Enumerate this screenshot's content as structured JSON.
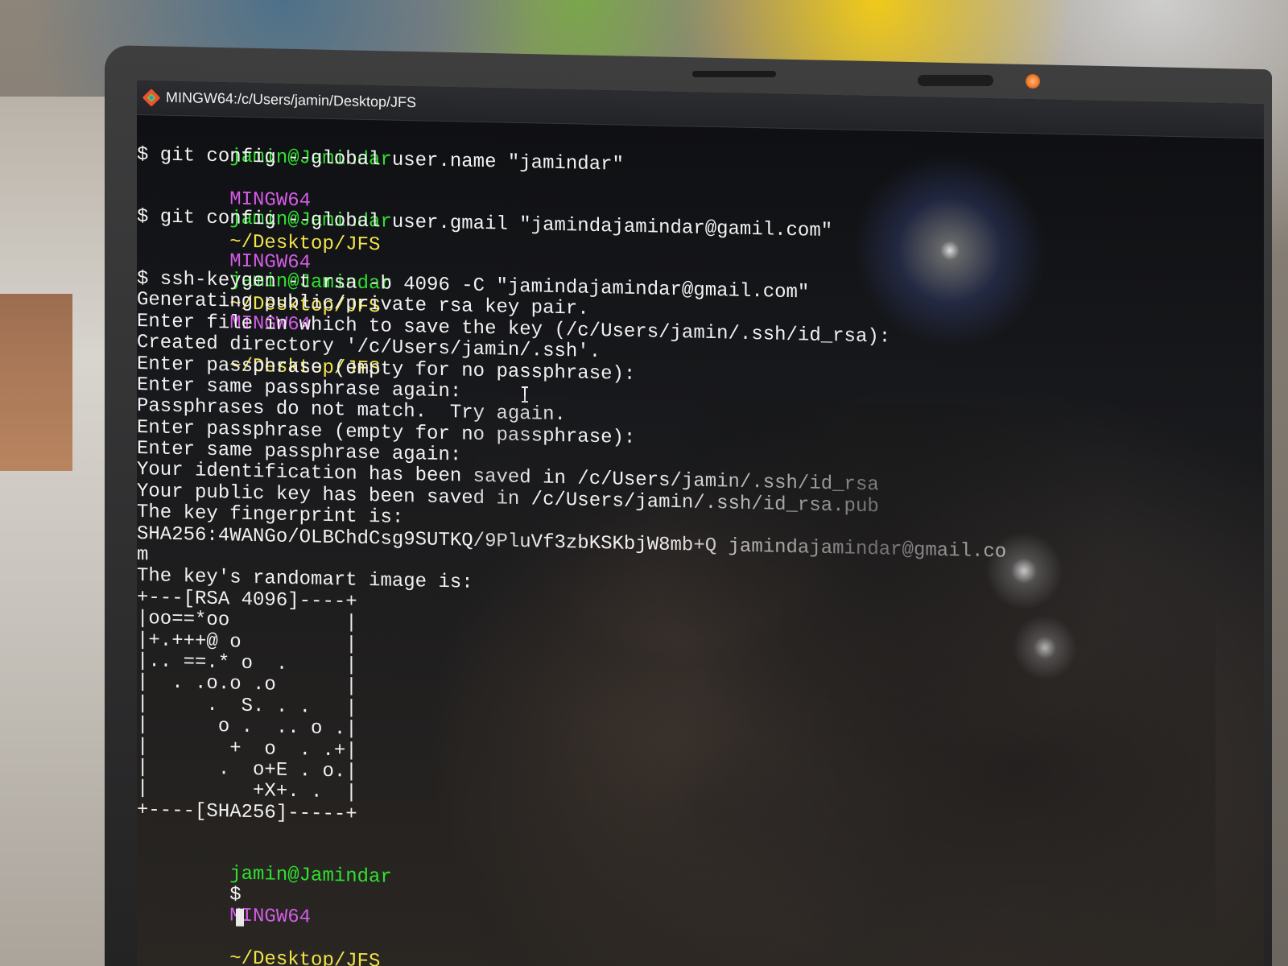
{
  "window": {
    "title": "MINGW64:/c/Users/jamin/Desktop/JFS"
  },
  "terminal": {
    "entries": [
      {
        "prompt": {
          "user": "jamin@Jamindar",
          "host": "MINGW64",
          "path": "~/Desktop/JFS"
        },
        "command": "$ git config --global user.name \"jamindar\"",
        "output": []
      },
      {
        "prompt": {
          "user": "jamin@Jamindar",
          "host": "MINGW64",
          "path": "~/Desktop/JFS"
        },
        "command": "$ git config --global user.gmail \"jamindajamindar@gamil.com\"",
        "output": []
      },
      {
        "prompt": {
          "user": "jamin@Jamindar",
          "host": "MINGW64",
          "path": "~/Desktop/JFS"
        },
        "command": "$ ssh-keygen -t rsa -b 4096 -C \"jamindajamindar@gmail.com\"",
        "output": [
          "Generating public/private rsa key pair.",
          "Enter file in which to save the key (/c/Users/jamin/.ssh/id_rsa):",
          "Created directory '/c/Users/jamin/.ssh'.",
          "Enter passphrase (empty for no passphrase):",
          "Enter same passphrase again:",
          "Passphrases do not match.  Try again.",
          "Enter passphrase (empty for no passphrase):",
          "Enter same passphrase again:",
          "Your identification has been saved in /c/Users/jamin/.ssh/id_rsa",
          "Your public key has been saved in /c/Users/jamin/.ssh/id_rsa.pub",
          "The key fingerprint is:",
          "SHA256:4WANGo/OLBChdCsg9SUTKQ/9PluVf3zbKSKbjW8mb+Q jamindajamindar@gmail.co",
          "m",
          "The key's randomart image is:",
          "+---[RSA 4096]----+",
          "|oo==*oo          |",
          "|+.+++@ o         |",
          "|.. ==.* o  .     |",
          "|  . .o.o .o      |",
          "|     .  S. . .   |",
          "|      o .  .. o .|",
          "|       +  o  . .+|",
          "|      .  o+E . o.|",
          "|         +X+. .  |",
          "+----[SHA256]-----+"
        ]
      },
      {
        "prompt": {
          "user": "jamin@Jamindar",
          "host": "MINGW64",
          "path": "~/Desktop/JFS"
        },
        "command": "$",
        "output": []
      }
    ]
  },
  "icons": {
    "app": "git-bash-icon",
    "text_cursor": "text-cursor-icon",
    "webcam": "webcam-icon"
  },
  "colors": {
    "prompt_user": "#2fe12f",
    "prompt_host": "#d45de6",
    "prompt_path": "#f1e44a",
    "terminal_text": "#f1f1f1"
  }
}
